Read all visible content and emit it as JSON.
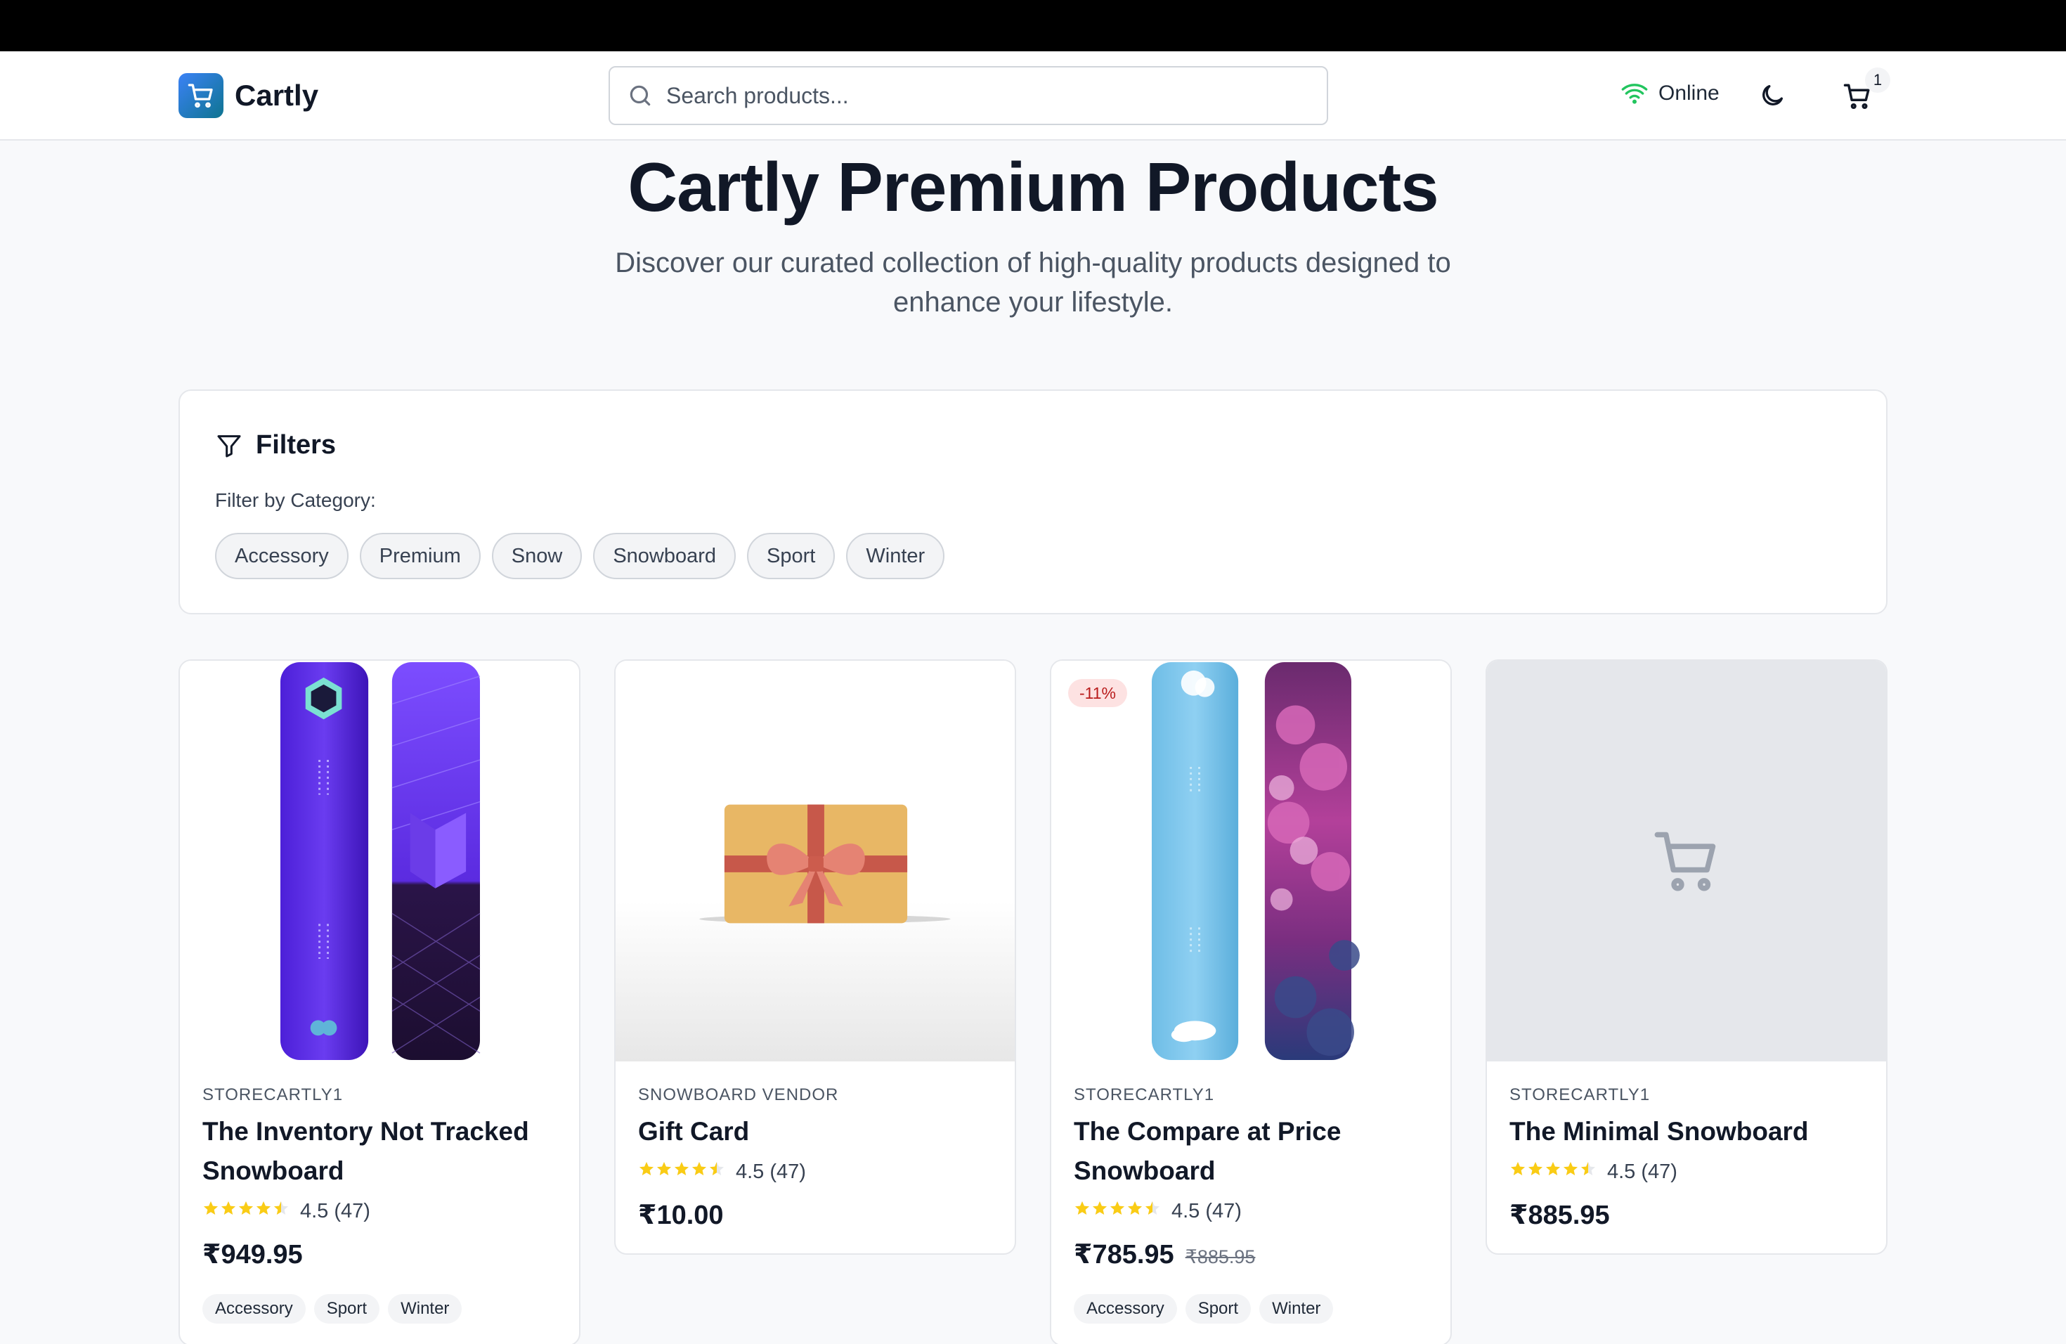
{
  "header": {
    "brand": "Cartly",
    "search_placeholder": "Search products...",
    "status": "Online",
    "cart_count": "1"
  },
  "hero": {
    "title": "Cartly Premium Products",
    "subtitle": "Discover our curated collection of high-quality products designed to enhance your lifestyle."
  },
  "filters": {
    "title": "Filters",
    "category_label": "Filter by Category:",
    "categories": [
      "Accessory",
      "Premium",
      "Snow",
      "Snowboard",
      "Sport",
      "Winter"
    ]
  },
  "products": [
    {
      "vendor": "STORECARTLY1",
      "name": "The Inventory Not Tracked Snowboard",
      "rating": "4.5 (47)",
      "rating_value": 4.5,
      "price": "₹949.95",
      "tags": [
        "Accessory",
        "Sport",
        "Winter"
      ]
    },
    {
      "vendor": "SNOWBOARD VENDOR",
      "name": "Gift Card",
      "rating": "4.5 (47)",
      "rating_value": 4.5,
      "price": "₹10.00"
    },
    {
      "vendor": "STORECARTLY1",
      "name": "The Compare at Price Snowboard",
      "rating": "4.5 (47)",
      "rating_value": 4.5,
      "price": "₹785.95",
      "compare_price": "₹885.95",
      "discount": "-11%",
      "tags": [
        "Accessory",
        "Sport",
        "Winter"
      ]
    },
    {
      "vendor": "STORECARTLY1",
      "name": "The Minimal Snowboard",
      "rating": "4.5 (47)",
      "rating_value": 4.5,
      "price": "₹885.95"
    }
  ],
  "colors": {
    "accent": "#3b82f6",
    "online": "#22c55e",
    "star": "#facc15",
    "discount_bg": "#fde2e2",
    "discount_text": "#b91c1c"
  }
}
